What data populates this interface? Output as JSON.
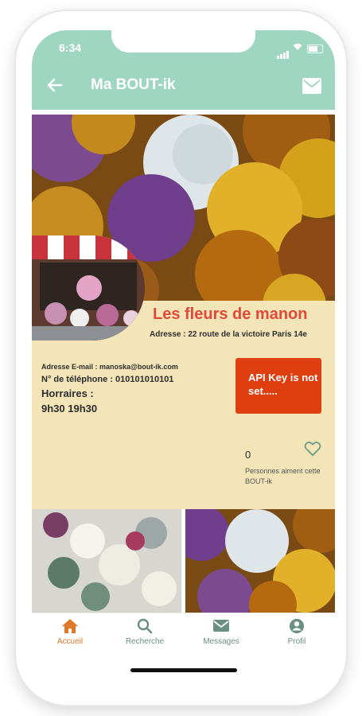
{
  "status": {
    "time": "6:34"
  },
  "header": {
    "title": "Ma BOUT-ik",
    "back_icon": "back-arrow-icon",
    "mail_icon": "mail-icon"
  },
  "shop": {
    "name": "Les fleurs de manon",
    "address": "Adresse : 22 route de la victoire  Paris 14e",
    "email": "Adresse E-mail : manoska@bout-ik.com",
    "phone": "N° de téléphone : 010101010101",
    "hours_label": "Horraires :",
    "hours": "9h30 19h30"
  },
  "api_button": {
    "label": "API Key is not set....."
  },
  "likes": {
    "count": "0",
    "label": "Personnes aiment cette BOUT-ik",
    "icon": "heart-outline-icon"
  },
  "tabs": [
    {
      "label": "Accueil",
      "icon": "home-icon",
      "active": true
    },
    {
      "label": "Recherche",
      "icon": "search-icon",
      "active": false
    },
    {
      "label": "Messages",
      "icon": "mail-icon",
      "active": false
    },
    {
      "label": "Profil",
      "icon": "profile-icon",
      "active": false
    }
  ],
  "colors": {
    "accent": "#9fd6c1",
    "card_background": "#f3e5b8",
    "shop_name": "#e0483a",
    "api_button": "#df3e10",
    "tab_active": "#e0782a",
    "tab_inactive": "#6b8f82"
  }
}
